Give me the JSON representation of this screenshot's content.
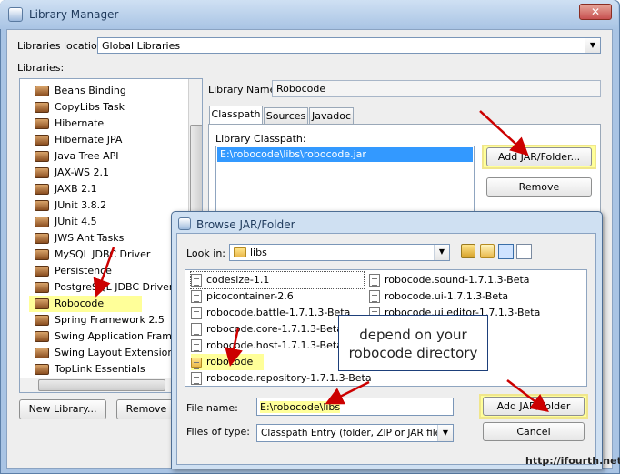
{
  "window": {
    "title": "Library Manager",
    "close_glyph": "✕"
  },
  "location": {
    "label": "Libraries location:",
    "value": "Global Libraries"
  },
  "libraries_label": "Libraries:",
  "libraries": [
    "Beans Binding",
    "CopyLibs Task",
    "Hibernate",
    "Hibernate JPA",
    "Java Tree API",
    "JAX-WS 2.1",
    "JAXB 2.1",
    "JUnit 3.8.2",
    "JUnit 4.5",
    "JWS Ant Tasks",
    "MySQL JDBC Driver",
    "Persistence",
    "PostgreSQL JDBC Driver",
    "Robocode",
    "Spring Framework 2.5",
    "Swing Application Framew",
    "Swing Layout Extensions",
    "TopLink Essentials"
  ],
  "selected_library": "Robocode",
  "buttons": {
    "new_library": "New Library...",
    "remove_library": "Remove",
    "add_jar": "Add JAR/Folder...",
    "remove": "Remove"
  },
  "library_name": {
    "label": "Library Name:",
    "value": "Robocode"
  },
  "tabs": [
    "Classpath",
    "Sources",
    "Javadoc"
  ],
  "classpath": {
    "label": "Library Classpath:",
    "entries": [
      "E:\\robocode\\libs\\robocode.jar"
    ]
  },
  "browse": {
    "title": "Browse JAR/Folder",
    "look_in_label": "Look in:",
    "look_in_value": "libs",
    "files_col1": [
      "codesize-1.1",
      "picocontainer-2.6",
      "robocode.battle-1.7.1.3-Beta",
      "robocode.core-1.7.1.3-Beta",
      "robocode.host-1.7.1.3-Beta",
      "robocode",
      "robocode.repository-1.7.1.3-Beta"
    ],
    "files_col2": [
      "robocode.sound-1.7.1.3-Beta",
      "robocode.ui-1.7.1.3-Beta",
      "robocode.ui.editor-1.7.1.3-Beta"
    ],
    "file_name_label": "File name:",
    "file_name_value": "E:\\robocode\\libs",
    "files_of_type_label": "Files of type:",
    "files_of_type_value": "Classpath Entry (folder, ZIP or JAR file)",
    "add_button": "Add JAR/Folder",
    "cancel_button": "Cancel"
  },
  "callout": {
    "line1": "depend on your",
    "line2": "robocode directory"
  },
  "watermark": "http://ifourth.net/",
  "colors": {
    "highlight": "#ffff99",
    "selection": "#3399ff",
    "arrow": "#cc0000"
  }
}
